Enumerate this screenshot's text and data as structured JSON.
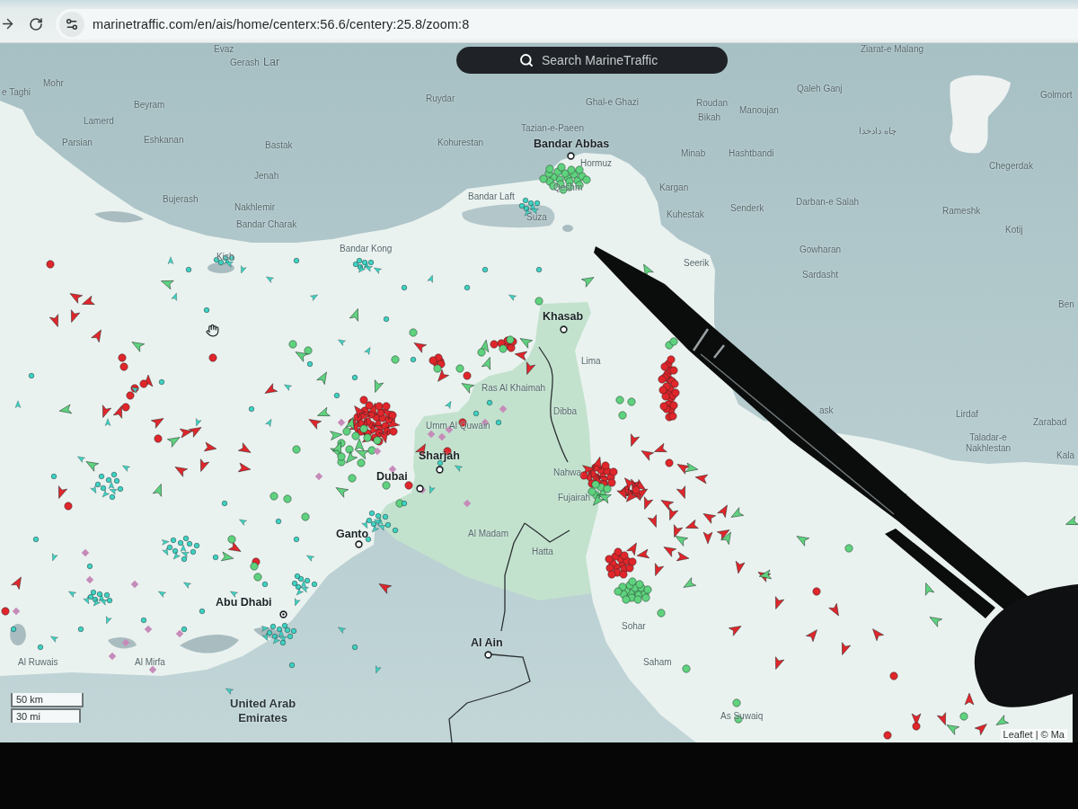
{
  "browser": {
    "url": "marinetraffic.com/en/ais/home/centerx:56.6/centery:25.8/zoom:8"
  },
  "map": {
    "search": {
      "placeholder": "Search MarineTraffic"
    },
    "places": [
      {
        "name": "Evaz",
        "kind": "town"
      },
      {
        "name": "Ziarat-e Malang",
        "kind": "town"
      },
      {
        "name": "Gerash",
        "kind": "town"
      },
      {
        "name": "Lar",
        "kind": "large_town"
      },
      {
        "name": "Mohr",
        "kind": "town"
      },
      {
        "name": "e Taghi",
        "kind": "town"
      },
      {
        "name": "Beyram",
        "kind": "town"
      },
      {
        "name": "Ruydar",
        "kind": "town"
      },
      {
        "name": "Ghal-e Ghazi",
        "kind": "town"
      },
      {
        "name": "Roudan",
        "kind": "town"
      },
      {
        "name": "Qaleh Ganj",
        "kind": "town"
      },
      {
        "name": "Golmort",
        "kind": "town"
      },
      {
        "name": "Manoujan",
        "kind": "town"
      },
      {
        "name": "Lamerd",
        "kind": "town"
      },
      {
        "name": "Bikah",
        "kind": "town"
      },
      {
        "name": "Tazian-e-Paeen",
        "kind": "town"
      },
      {
        "name": "چاه دادخدا",
        "kind": "town"
      },
      {
        "name": "Parsian",
        "kind": "town"
      },
      {
        "name": "Eshkanan",
        "kind": "town"
      },
      {
        "name": "Bastak",
        "kind": "town"
      },
      {
        "name": "Kohurestan",
        "kind": "town"
      },
      {
        "name": "Bandar Abbas",
        "kind": "city"
      },
      {
        "name": "Minab",
        "kind": "town"
      },
      {
        "name": "Hashtbandi",
        "kind": "town"
      },
      {
        "name": "Hormuz",
        "kind": "town"
      },
      {
        "name": "Chegerdak",
        "kind": "town"
      },
      {
        "name": "Jenah",
        "kind": "town"
      },
      {
        "name": "Qeshm",
        "kind": "town"
      },
      {
        "name": "Kargan",
        "kind": "town"
      },
      {
        "name": "Bujerash",
        "kind": "town"
      },
      {
        "name": "Nakhlemir",
        "kind": "town"
      },
      {
        "name": "Bandar Laft",
        "kind": "town"
      },
      {
        "name": "Suza",
        "kind": "town"
      },
      {
        "name": "Kuhestak",
        "kind": "town"
      },
      {
        "name": "Senderk",
        "kind": "town"
      },
      {
        "name": "Darban-e Salah",
        "kind": "town"
      },
      {
        "name": "Rameshk",
        "kind": "town"
      },
      {
        "name": "Bandar Charak",
        "kind": "town"
      },
      {
        "name": "Kotij",
        "kind": "town"
      },
      {
        "name": "Kish",
        "kind": "town"
      },
      {
        "name": "Bandar Kong",
        "kind": "town"
      },
      {
        "name": "Gowharan",
        "kind": "town"
      },
      {
        "name": "Seerik",
        "kind": "town"
      },
      {
        "name": "Sardasht",
        "kind": "town"
      },
      {
        "name": "Ben",
        "kind": "town"
      },
      {
        "name": "Khasab",
        "kind": "city"
      },
      {
        "name": "Lima",
        "kind": "town"
      },
      {
        "name": "Ras Al Khaimah",
        "kind": "town"
      },
      {
        "name": "Dibba",
        "kind": "town"
      },
      {
        "name": "ask",
        "kind": "town"
      },
      {
        "name": "Lirdaf",
        "kind": "town"
      },
      {
        "name": "Umm Al Quwain",
        "kind": "town"
      },
      {
        "name": "Zarabad",
        "kind": "town"
      },
      {
        "name": "Sharjah",
        "kind": "city"
      },
      {
        "name": "Taladar-e\nNakhlestan",
        "kind": "town"
      },
      {
        "name": "Kala",
        "kind": "town"
      },
      {
        "name": "Dubai",
        "kind": "city"
      },
      {
        "name": "Nahwa",
        "kind": "town"
      },
      {
        "name": "Fujairah",
        "kind": "town"
      },
      {
        "name": "Ganto",
        "kind": "city"
      },
      {
        "name": "Al Madam",
        "kind": "town"
      },
      {
        "name": "Hatta",
        "kind": "town"
      },
      {
        "name": "Abu Dhabi",
        "kind": "city"
      },
      {
        "name": "Sohar",
        "kind": "town"
      },
      {
        "name": "Al Ain",
        "kind": "city"
      },
      {
        "name": "Al Ruwais",
        "kind": "town"
      },
      {
        "name": "Al Mirfa",
        "kind": "town"
      },
      {
        "name": "Saham",
        "kind": "town"
      },
      {
        "name": "United Arab\nEmirates",
        "kind": "country"
      },
      {
        "name": "As Suwaiq",
        "kind": "town"
      }
    ],
    "vessel_layers": [
      {
        "color": "#e0262b"
      },
      {
        "color": "#5fd27e"
      },
      {
        "color": "#3cd3c3"
      },
      {
        "color": "#c68bb9"
      }
    ],
    "scale": [
      "50 km",
      "30 mi"
    ],
    "attribution": "Leaflet | © Ma"
  }
}
